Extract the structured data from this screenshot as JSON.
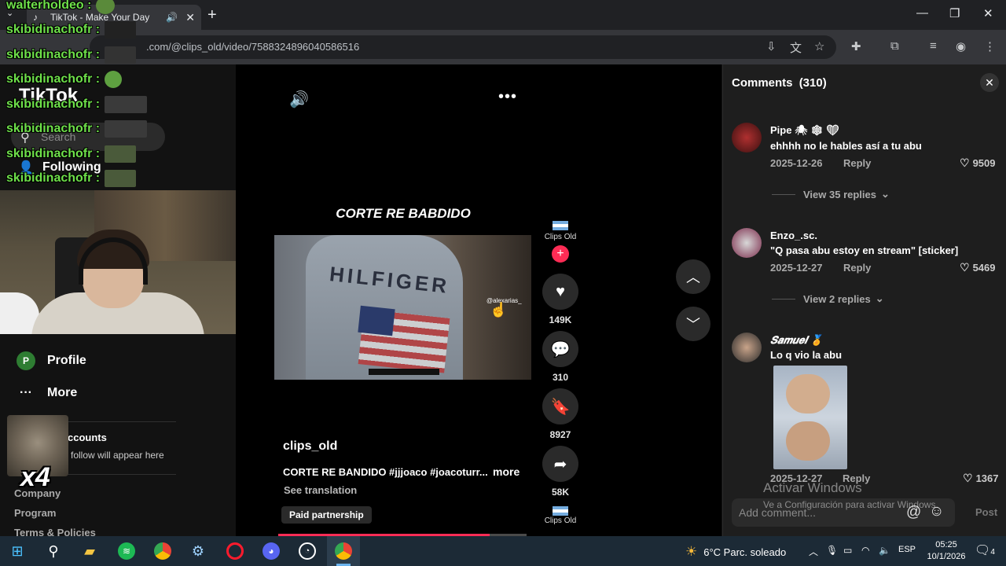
{
  "browser": {
    "tab_title": "TikTok - Make Your Day",
    "url": "tiktok.com/@clips_old/video/7588324896040586516",
    "url_visible": ".com/@clips_old/video/7588324896040586516"
  },
  "tiktok": {
    "logo": "TikTok",
    "search_placeholder": "Search",
    "nav": [
      {
        "label": "Following",
        "icon": "following-icon"
      },
      {
        "label": "Profile",
        "icon": "profile-icon",
        "badge": "P"
      },
      {
        "label": "More",
        "icon": "more-icon"
      }
    ],
    "accounts_title": "ccounts",
    "accounts_sub": "follow will appear here",
    "footer": [
      "Company",
      "Program",
      "Terms & Policies"
    ]
  },
  "overlay": {
    "chat_top": "walterholdeo :",
    "chat": [
      "skibidinachofr :",
      "skibidinachofr :",
      "skibidinachofr :",
      "skibidinachofr :",
      "skibidinachofr :",
      "skibidinachofr :",
      "skibidinachofr :"
    ],
    "multiplier": "x4"
  },
  "video": {
    "caption_top": "CORTE RE BABDIDO",
    "watermark_handle": "@alexarias_",
    "author": "clips_old",
    "description": "CORTE RE BANDIDO #jjjoaco #joacoturr...",
    "more_label": "more",
    "see_translation": "See translation",
    "paid_label": "Paid partnership",
    "progress": 0.85,
    "creator_name": "Clips Old",
    "likes": "149K",
    "comments": "310",
    "saves": "8927",
    "shares": "58K"
  },
  "comments_panel": {
    "title": "Comments",
    "count": "(310)",
    "items": [
      {
        "user": "Pipe 🕷 ❄ ❤",
        "text": "ehhhh no le hables así a tu abu",
        "date": "2025-12-26",
        "reply": "Reply",
        "likes": "9509",
        "view_replies": "View 35 replies"
      },
      {
        "user": "Enzo_.sc.",
        "text": "\"Q pasa abu estoy en stream\" [sticker]",
        "date": "2025-12-27",
        "reply": "Reply",
        "likes": "5469",
        "view_replies": "View 2 replies"
      },
      {
        "user": "𝑺𝒂𝒎𝒖𝒆𝒍 🏅",
        "text": "Lo q vio la abu",
        "date": "2025-12-27",
        "reply": "Reply",
        "likes": "1367"
      }
    ],
    "add_placeholder": "Add comment...",
    "post_label": "Post"
  },
  "windows": {
    "activate_title": "Activar Windows",
    "activate_sub": "Ve a Configuración para activar Windows.",
    "weather": "6°C  Parc. soleado",
    "lang": "ESP",
    "time": "05:25",
    "date": "10/1/2026",
    "notifications": "4"
  },
  "colors": {
    "accent": "#fe2c55",
    "chat_green": "#6ee04a",
    "panel_bg": "#1e1e1e"
  }
}
